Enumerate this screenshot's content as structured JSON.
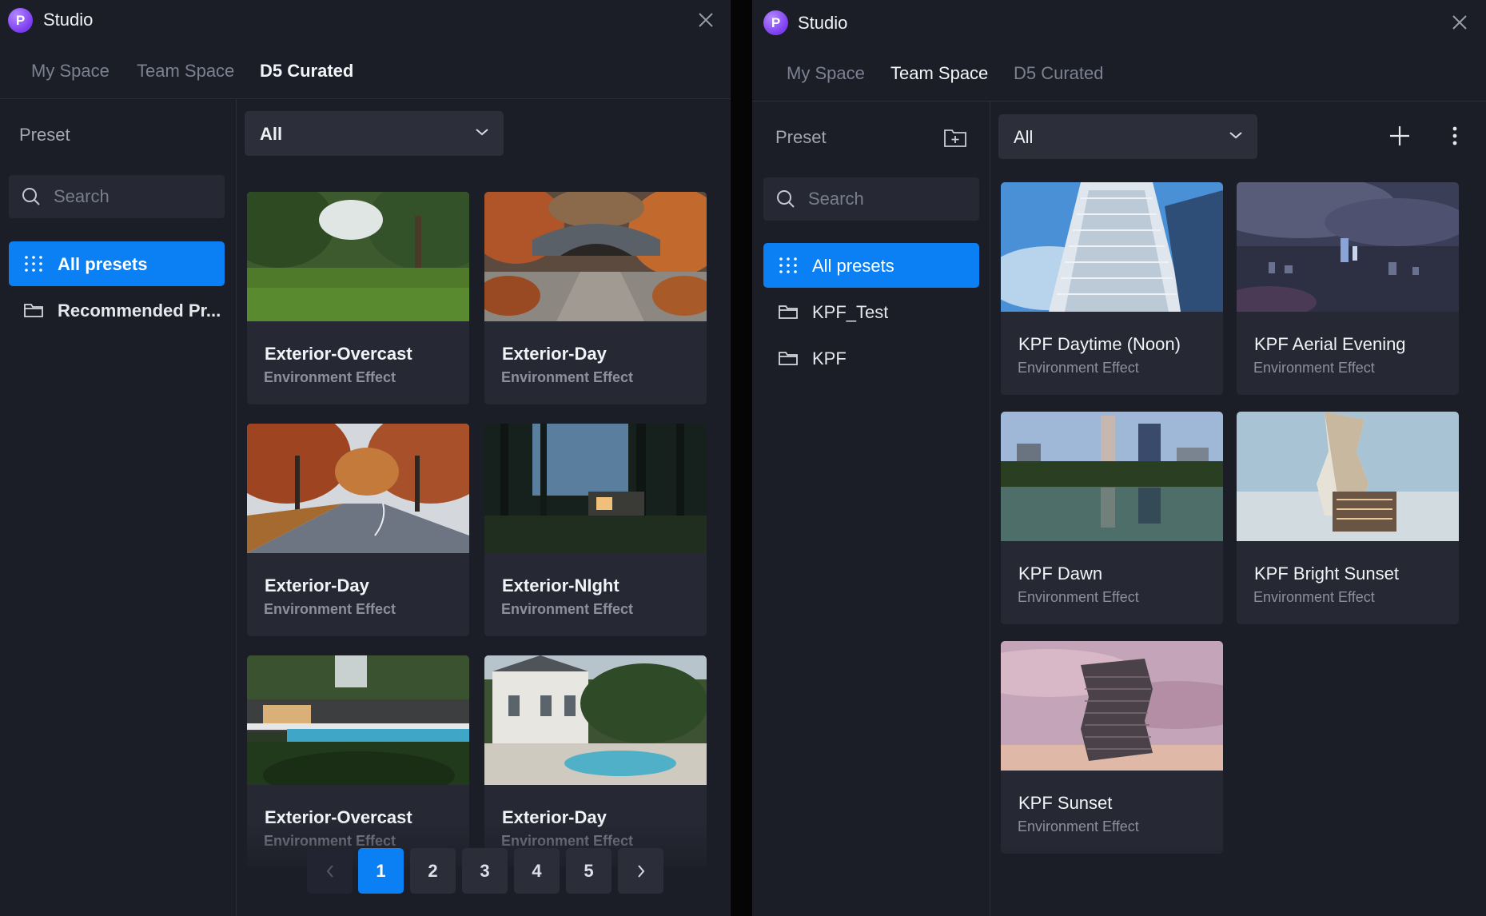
{
  "left": {
    "app_title": "Studio",
    "logo_letter": "P",
    "tabs": [
      {
        "label": "My Space"
      },
      {
        "label": "Team Space"
      },
      {
        "label": "D5 Curated"
      }
    ],
    "active_tab": "D5 Curated",
    "sidebar": {
      "preset_label": "Preset",
      "search_placeholder": "Search",
      "items": [
        {
          "label": "All presets",
          "icon": "grid-dots-icon",
          "active": true
        },
        {
          "label": "Recommended Pr...",
          "icon": "folder-icon",
          "active": false
        }
      ]
    },
    "filter": {
      "selected": "All"
    },
    "cards": [
      {
        "title": "Exterior-Overcast",
        "subtitle": "Environment Effect"
      },
      {
        "title": "Exterior-Day",
        "subtitle": "Environment Effect"
      },
      {
        "title": "Exterior-Day",
        "subtitle": "Environment Effect"
      },
      {
        "title": "Exterior-NIght",
        "subtitle": "Environment Effect"
      },
      {
        "title": "Exterior-Overcast",
        "subtitle": "Environment Effect"
      },
      {
        "title": "Exterior-Day",
        "subtitle": "Environment Effect"
      }
    ],
    "pagination": {
      "pages": [
        "1",
        "2",
        "3",
        "4",
        "5"
      ],
      "current": "1"
    }
  },
  "right": {
    "app_title": "Studio",
    "logo_letter": "P",
    "tabs": [
      {
        "label": "My Space"
      },
      {
        "label": "Team Space"
      },
      {
        "label": "D5 Curated"
      }
    ],
    "active_tab": "Team Space",
    "sidebar": {
      "preset_label": "Preset",
      "search_placeholder": "Search",
      "items": [
        {
          "label": "All presets",
          "icon": "grid-dots-icon",
          "active": true
        },
        {
          "label": "KPF_Test",
          "icon": "folder-icon",
          "active": false
        },
        {
          "label": "KPF",
          "icon": "folder-icon",
          "active": false
        }
      ]
    },
    "filter": {
      "selected": "All"
    },
    "cards": [
      {
        "title": "KPF Daytime (Noon)",
        "subtitle": "Environment Effect"
      },
      {
        "title": "KPF Aerial Evening",
        "subtitle": "Environment Effect"
      },
      {
        "title": "KPF Dawn",
        "subtitle": "Environment Effect"
      },
      {
        "title": "KPF Bright Sunset",
        "subtitle": "Environment Effect"
      },
      {
        "title": "KPF Sunset",
        "subtitle": "Environment Effect"
      }
    ]
  },
  "colors": {
    "accent": "#0b80f4",
    "panel_bg": "#1c1e27",
    "card_bg": "#262834"
  }
}
